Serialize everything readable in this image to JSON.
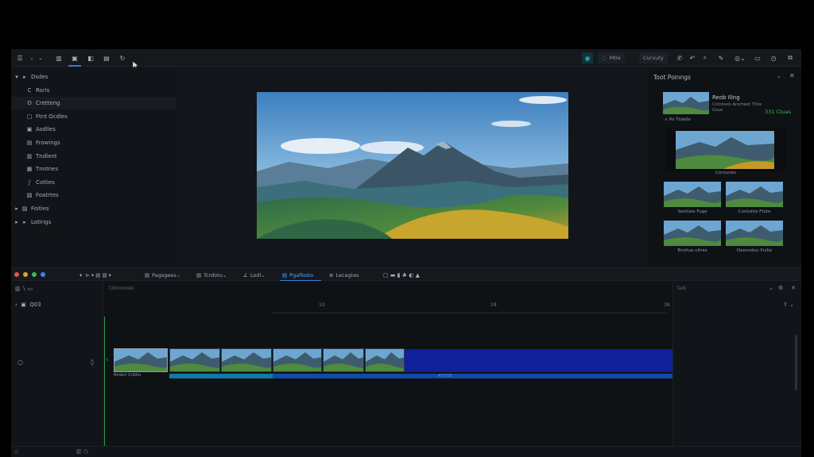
{
  "toolbar": {
    "left_icons": [
      "menu-icon",
      "chevron-down-icon",
      "chevron-down-icon",
      "grid-icon",
      "media-icon",
      "layers-icon",
      "copy-icon",
      "refresh-icon"
    ],
    "pill_1": "Mtle",
    "pill_2": "Curvuty",
    "right_icons": [
      "phone-icon",
      "curve-icon",
      "search-icon",
      "brush-icon",
      "circle-icon",
      "screen-icon",
      "clock-icon",
      "export-icon"
    ]
  },
  "sidebar": {
    "items": [
      {
        "label": "Dsdes",
        "icon": "▸",
        "arrow": "▾",
        "selected": false
      },
      {
        "label": "Rorls",
        "icon": "C",
        "arrow": "",
        "selected": false
      },
      {
        "label": "Cretteng",
        "icon": "O",
        "arrow": "",
        "selected": true
      },
      {
        "label": "Ftnt Ocdles",
        "icon": "▢",
        "arrow": "",
        "selected": false
      },
      {
        "label": "Asdlles",
        "icon": "▣",
        "arrow": "",
        "selected": false
      },
      {
        "label": "Frowings",
        "icon": "▤",
        "arrow": "",
        "selected": false
      },
      {
        "label": "Tndlent",
        "icon": "▥",
        "arrow": "",
        "selected": false
      },
      {
        "label": "Tnotnes",
        "icon": "▦",
        "arrow": "",
        "selected": false
      },
      {
        "label": "Cotlies",
        "icon": "∫",
        "arrow": "",
        "selected": false
      },
      {
        "label": "Foatrtes",
        "icon": "▧",
        "arrow": "",
        "selected": false
      },
      {
        "label": "Foities",
        "icon": "▨",
        "arrow": "▸",
        "selected": false
      },
      {
        "label": "Lotings",
        "icon": "▸",
        "arrow": "▸",
        "selected": false
      }
    ],
    "slider_value": 0.55
  },
  "right_panel": {
    "title": "Toot Poinngs",
    "featured_title": "Reob Illng",
    "featured_sub": "Cotnlnets Arocheet Tthie",
    "featured_sub2": "Goue",
    "featured_count": "331 Ctuas",
    "featured_link": "Po Ttdelle",
    "captions": [
      "Contunes",
      "Seotlaie Fuge",
      "Contolire Ftote",
      "Brotlue ultres",
      "Deonsduu Puilie"
    ]
  },
  "timeline_toolbar": {
    "tabs": [
      {
        "label": "Pagsgees",
        "icon": "▤"
      },
      {
        "label": "Tcrdotu",
        "icon": "▤"
      },
      {
        "label": "Lodl",
        "icon": "∠"
      },
      {
        "label": "Pgaflosto",
        "icon": "▤"
      },
      {
        "label": "Lecagtes",
        "icon": "⊕"
      }
    ],
    "dot_colors": [
      "#e5534b",
      "#e3a129",
      "#3fb950",
      "#3b82f6"
    ]
  },
  "timeline": {
    "track_header": "Cbnnonies",
    "track_name": "Q03",
    "ticks": [
      "10",
      "18",
      "38"
    ],
    "clip_caption": "Rmbrl Crblio",
    "audio_label": "AOTGE",
    "right_col_title": "Tadi"
  }
}
